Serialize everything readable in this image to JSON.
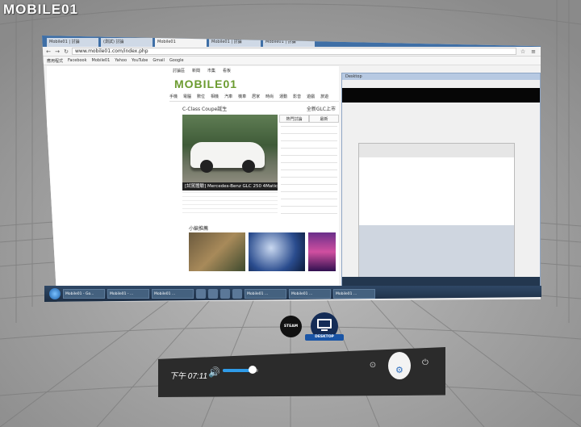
{
  "watermark": {
    "brand": "MOBILE01"
  },
  "browser": {
    "tabs": [
      "Mobile01 | 討論",
      "(測試) 討論",
      "Mobile01",
      "Mobile01 | 討論",
      "Mobile01 | 討論"
    ],
    "url": "www.mobile01.com/index.php",
    "bookmarks": [
      "應用程式",
      "Facebook",
      "Mobile01",
      "Yahoo",
      "YouTube",
      "Gmail",
      "Google"
    ],
    "top_nav": [
      "討論區",
      "新聞",
      "市集",
      "看板"
    ],
    "site_logo": "MOBILE01",
    "category_nav": [
      "手機",
      "電腦",
      "數位",
      "相機",
      "汽車",
      "機車",
      "居家",
      "時尚",
      "運動",
      "影音",
      "遊戲",
      "旅遊"
    ],
    "headline_left": "C-Class Coupe誕生",
    "headline_right": "全新GLC上市",
    "hero_caption": "[試駕體驗] Mercedes-Benz GLC 250 4Matic",
    "side_tabs": [
      "熱門討論",
      "最新"
    ],
    "section_title": "小編推薦",
    "thumb_captions": [
      "",
      "",
      ""
    ]
  },
  "inner_window": {
    "title": "Desktop"
  },
  "taskbar": {
    "items": [
      "Mobile01 - Go...",
      "Mobile01 - ...",
      "Mobile01 ...",
      "Mobile01 ...",
      "Mobile01 ...",
      "Mobile01 ..."
    ]
  },
  "launcher": {
    "steam_label": "STEAM",
    "desktop_label": "DESKTOP"
  },
  "controls": {
    "time": "下午 07:11",
    "volume_level": 0.85
  },
  "colors": {
    "accent": "#2f9be8",
    "desktop_button": "#142c56",
    "control_bar": "#2b2b2b"
  },
  "icons": {
    "speaker": "speaker-icon",
    "target": "target-icon",
    "settings": "gear-icon",
    "power": "power-icon",
    "monitor": "monitor-icon"
  }
}
